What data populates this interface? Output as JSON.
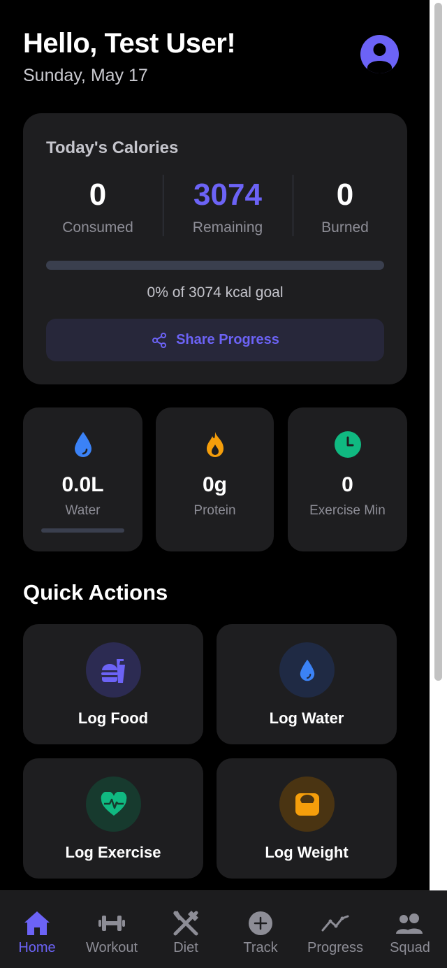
{
  "header": {
    "greeting": "Hello, Test User!",
    "date": "Sunday, May 17"
  },
  "calories": {
    "title": "Today's Calories",
    "consumed": {
      "value": "0",
      "label": "Consumed"
    },
    "remaining": {
      "value": "3074",
      "label": "Remaining"
    },
    "burned": {
      "value": "0",
      "label": "Burned"
    },
    "progress_percent": 0,
    "goal_text": "0% of 3074 kcal goal",
    "share_label": "Share Progress"
  },
  "stats": {
    "water": {
      "value": "0.0L",
      "label": "Water",
      "progress_percent": 0
    },
    "protein": {
      "value": "0g",
      "label": "Protein"
    },
    "exercise": {
      "value": "0",
      "label": "Exercise Min"
    }
  },
  "quick_actions": {
    "title": "Quick Actions",
    "items": [
      {
        "label": "Log Food",
        "icon": "burger-drink-icon"
      },
      {
        "label": "Log Water",
        "icon": "water-drop-icon"
      },
      {
        "label": "Log Exercise",
        "icon": "heart-pulse-icon"
      },
      {
        "label": "Log Weight",
        "icon": "weight-icon"
      }
    ]
  },
  "nav": {
    "items": [
      {
        "label": "Home",
        "icon": "home-icon",
        "active": true
      },
      {
        "label": "Workout",
        "icon": "dumbbell-icon"
      },
      {
        "label": "Diet",
        "icon": "utensils-icon"
      },
      {
        "label": "Track",
        "icon": "plus-circle-icon"
      },
      {
        "label": "Progress",
        "icon": "trend-line-icon"
      },
      {
        "label": "Squad",
        "icon": "users-icon"
      }
    ]
  },
  "colors": {
    "accent": "#6c63f6",
    "water": "#3b82f6",
    "protein": "#f59e0b",
    "exercise": "#10b981",
    "card": "#1e1e20",
    "background": "#000000"
  }
}
